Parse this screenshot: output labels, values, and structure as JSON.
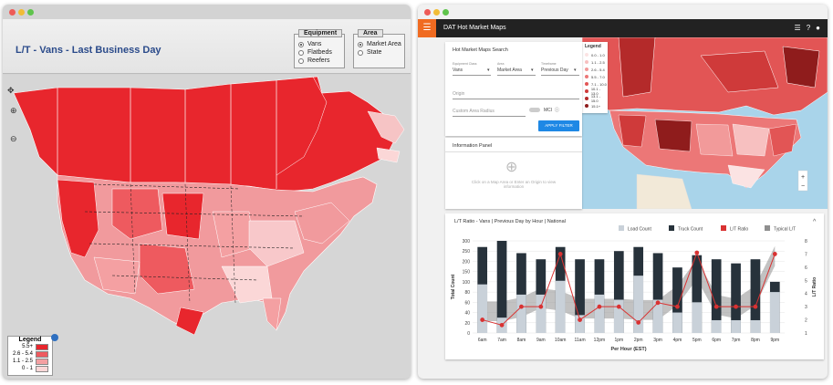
{
  "left_window": {
    "title": "L/T - Vans - Last Business Day",
    "equipment": {
      "legend": "Equipment",
      "options": [
        {
          "label": "Vans",
          "selected": true
        },
        {
          "label": "Flatbeds",
          "selected": false
        },
        {
          "label": "Reefers",
          "selected": false
        }
      ]
    },
    "area": {
      "legend": "Area",
      "options": [
        {
          "label": "Market Area",
          "selected": true
        },
        {
          "label": "State",
          "selected": false
        }
      ]
    },
    "legend": {
      "title": "Legend",
      "rows": [
        {
          "label": "5.5+",
          "color": "#e8262d"
        },
        {
          "label": "2.6 - 5.4",
          "color": "#ee5a5f"
        },
        {
          "label": "1.1 - 2.5",
          "color": "#f4a0a2"
        },
        {
          "label": "0 - 1",
          "color": "#fbd7d7"
        }
      ]
    }
  },
  "right_window": {
    "app_title": "DAT Hot Market Maps",
    "search": {
      "heading": "Hot Market Maps Search",
      "equipment_label": "Equipment Class",
      "equipment_value": "Vans",
      "area_label": "Area",
      "area_value": "Market Area",
      "timeframe_label": "Timeframe",
      "timeframe_value": "Previous Day",
      "origin_placeholder": "Origin",
      "radius_placeholder": "Custom Area Radius",
      "mci_label": "MCI",
      "apply_label": "APPLY FILTER"
    },
    "info_panel": {
      "heading": "Information Panel",
      "hint": "Click on a Map Area or Enter an Origin to view information"
    },
    "map_legend": {
      "title": "Legend",
      "rows": [
        {
          "label": "0.0 - 1.0",
          "color": "#fbe3e3"
        },
        {
          "label": "1.1 - 2.5",
          "color": "#f7c0c0"
        },
        {
          "label": "2.6 - 5.4",
          "color": "#f29a9a"
        },
        {
          "label": "5.5 - 7.0",
          "color": "#ec7777"
        },
        {
          "label": "7.1 - 10.0",
          "color": "#e25555"
        },
        {
          "label": "10.1 - 13.0",
          "color": "#cf3a3a"
        },
        {
          "label": "13.1 - 15.0",
          "color": "#b42a2a"
        },
        {
          "label": "15.1+",
          "color": "#8f1c1c"
        }
      ]
    },
    "zoom": {
      "plus": "+",
      "minus": "−"
    }
  },
  "chart_data": {
    "type": "bar",
    "title": "L/T Ratio - Vans | Previous Day by Hour | National",
    "xlabel": "Per Hour (EST)",
    "ylabel": "Total Count",
    "y2label": "L/T Ratio",
    "categories": [
      "6am",
      "7am",
      "8am",
      "9am",
      "10am",
      "11am",
      "12pm",
      "1pm",
      "2pm",
      "3pm",
      "4pm",
      "5pm",
      "6pm",
      "7pm",
      "8pm",
      "9pm"
    ],
    "ylim": [
      0,
      300
    ],
    "y2lim": [
      1,
      8
    ],
    "yticks": [
      0,
      20,
      40,
      60,
      80,
      100,
      150,
      200,
      250,
      300
    ],
    "y2ticks": [
      1,
      2,
      3,
      4,
      5,
      6,
      7,
      8
    ],
    "series": [
      {
        "name": "Load Count",
        "type": "bar",
        "color": "#c9d1d9",
        "values": [
          95,
          30,
          75,
          75,
          105,
          35,
          75,
          65,
          130,
          65,
          40,
          60,
          25,
          25,
          25,
          80
        ]
      },
      {
        "name": "Truck Count",
        "type": "bar",
        "color": "#27323b",
        "values": [
          270,
          300,
          240,
          210,
          270,
          210,
          210,
          250,
          270,
          240,
          170,
          230,
          210,
          190,
          210,
          100
        ]
      },
      {
        "name": "L/T Ratio",
        "type": "line",
        "color": "#d93232",
        "values": [
          2.0,
          1.6,
          3.0,
          3.0,
          7.0,
          2.0,
          3.0,
          3.0,
          1.8,
          3.3,
          3.0,
          7.1,
          3.0,
          3.0,
          3.0,
          7.0
        ]
      },
      {
        "name": "Typical L/T",
        "type": "area",
        "color": "#8f8f8f",
        "values": [
          2.8,
          2.8,
          3.1,
          3.8,
          3.6,
          3.0,
          3.0,
          3.0,
          2.9,
          2.9,
          4.0,
          6.0,
          3.3,
          3.0,
          4.0,
          7.0
        ]
      }
    ],
    "legend_placement": "top-right"
  }
}
